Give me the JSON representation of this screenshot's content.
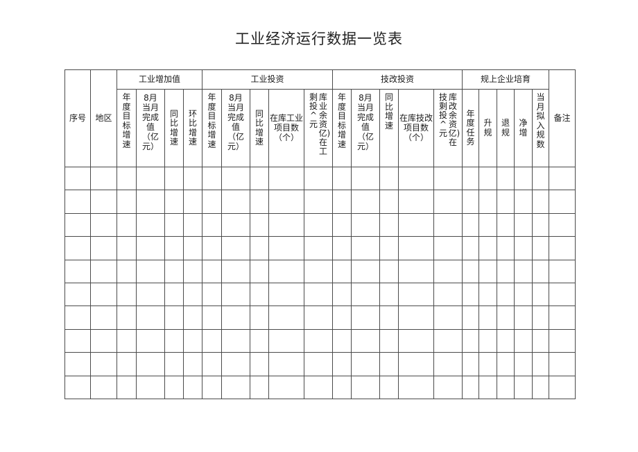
{
  "title": "工业经济运行数据一览表",
  "headers": {
    "seq": "序号",
    "region": "地区",
    "remarks": "备注",
    "groups": {
      "industrial_value_added": "工业增加值",
      "industrial_investment": "工业投资",
      "tech_renovation_investment": "技改投资",
      "enterprise_cultivation": "规上企业培育"
    },
    "industrial_value_added": {
      "annual_target_growth": "年度目标增速",
      "monthly_value": "8月当月完成值（亿元）",
      "yoy_growth": "同比增速",
      "mom_growth": "环比增速"
    },
    "industrial_investment": {
      "annual_target_growth": "年度目标增速",
      "monthly_value": "8月当月完成值（亿元）",
      "yoy_growth": "同比增速",
      "projects_in_stock": "在库工业 项目数（个）",
      "remaining_investment_a": "剩投^元",
      "remaining_investment_b": "库业余资亿)在工"
    },
    "tech_renovation_investment": {
      "annual_target_growth": "年度目标增速",
      "monthly_value": "8月当月完成值（亿元）",
      "yoy_growth": "同比增速",
      "projects_in_stock": "在库技改 项目数（个）",
      "remaining_investment_a": "技剩投^元",
      "remaining_investment_b": "库改余资亿)在"
    },
    "enterprise_cultivation": {
      "annual_task": "年度任务",
      "upgraded": "升规",
      "downgraded": "退规",
      "net_increase": "净增",
      "monthly_planned": "当月拟入规数"
    }
  },
  "rows": [
    [
      "",
      "",
      "",
      "",
      "",
      "",
      "",
      "",
      "",
      "",
      "",
      "",
      "",
      "",
      "",
      "",
      "",
      "",
      "",
      "",
      "",
      ""
    ],
    [
      "",
      "",
      "",
      "",
      "",
      "",
      "",
      "",
      "",
      "",
      "",
      "",
      "",
      "",
      "",
      "",
      "",
      "",
      "",
      "",
      "",
      ""
    ],
    [
      "",
      "",
      "",
      "",
      "",
      "",
      "",
      "",
      "",
      "",
      "",
      "",
      "",
      "",
      "",
      "",
      "",
      "",
      "",
      "",
      "",
      ""
    ],
    [
      "",
      "",
      "",
      "",
      "",
      "",
      "",
      "",
      "",
      "",
      "",
      "",
      "",
      "",
      "",
      "",
      "",
      "",
      "",
      "",
      "",
      ""
    ],
    [
      "",
      "",
      "",
      "",
      "",
      "",
      "",
      "",
      "",
      "",
      "",
      "",
      "",
      "",
      "",
      "",
      "",
      "",
      "",
      "",
      "",
      ""
    ],
    [
      "",
      "",
      "",
      "",
      "",
      "",
      "",
      "",
      "",
      "",
      "",
      "",
      "",
      "",
      "",
      "",
      "",
      "",
      "",
      "",
      "",
      ""
    ],
    [
      "",
      "",
      "",
      "",
      "",
      "",
      "",
      "",
      "",
      "",
      "",
      "",
      "",
      "",
      "",
      "",
      "",
      "",
      "",
      "",
      "",
      ""
    ],
    [
      "",
      "",
      "",
      "",
      "",
      "",
      "",
      "",
      "",
      "",
      "",
      "",
      "",
      "",
      "",
      "",
      "",
      "",
      "",
      "",
      "",
      ""
    ],
    [
      "",
      "",
      "",
      "",
      "",
      "",
      "",
      "",
      "",
      "",
      "",
      "",
      "",
      "",
      "",
      "",
      "",
      "",
      "",
      "",
      "",
      ""
    ],
    [
      "",
      "",
      "",
      "",
      "",
      "",
      "",
      "",
      "",
      "",
      "",
      "",
      "",
      "",
      "",
      "",
      "",
      "",
      "",
      "",
      "",
      ""
    ]
  ]
}
